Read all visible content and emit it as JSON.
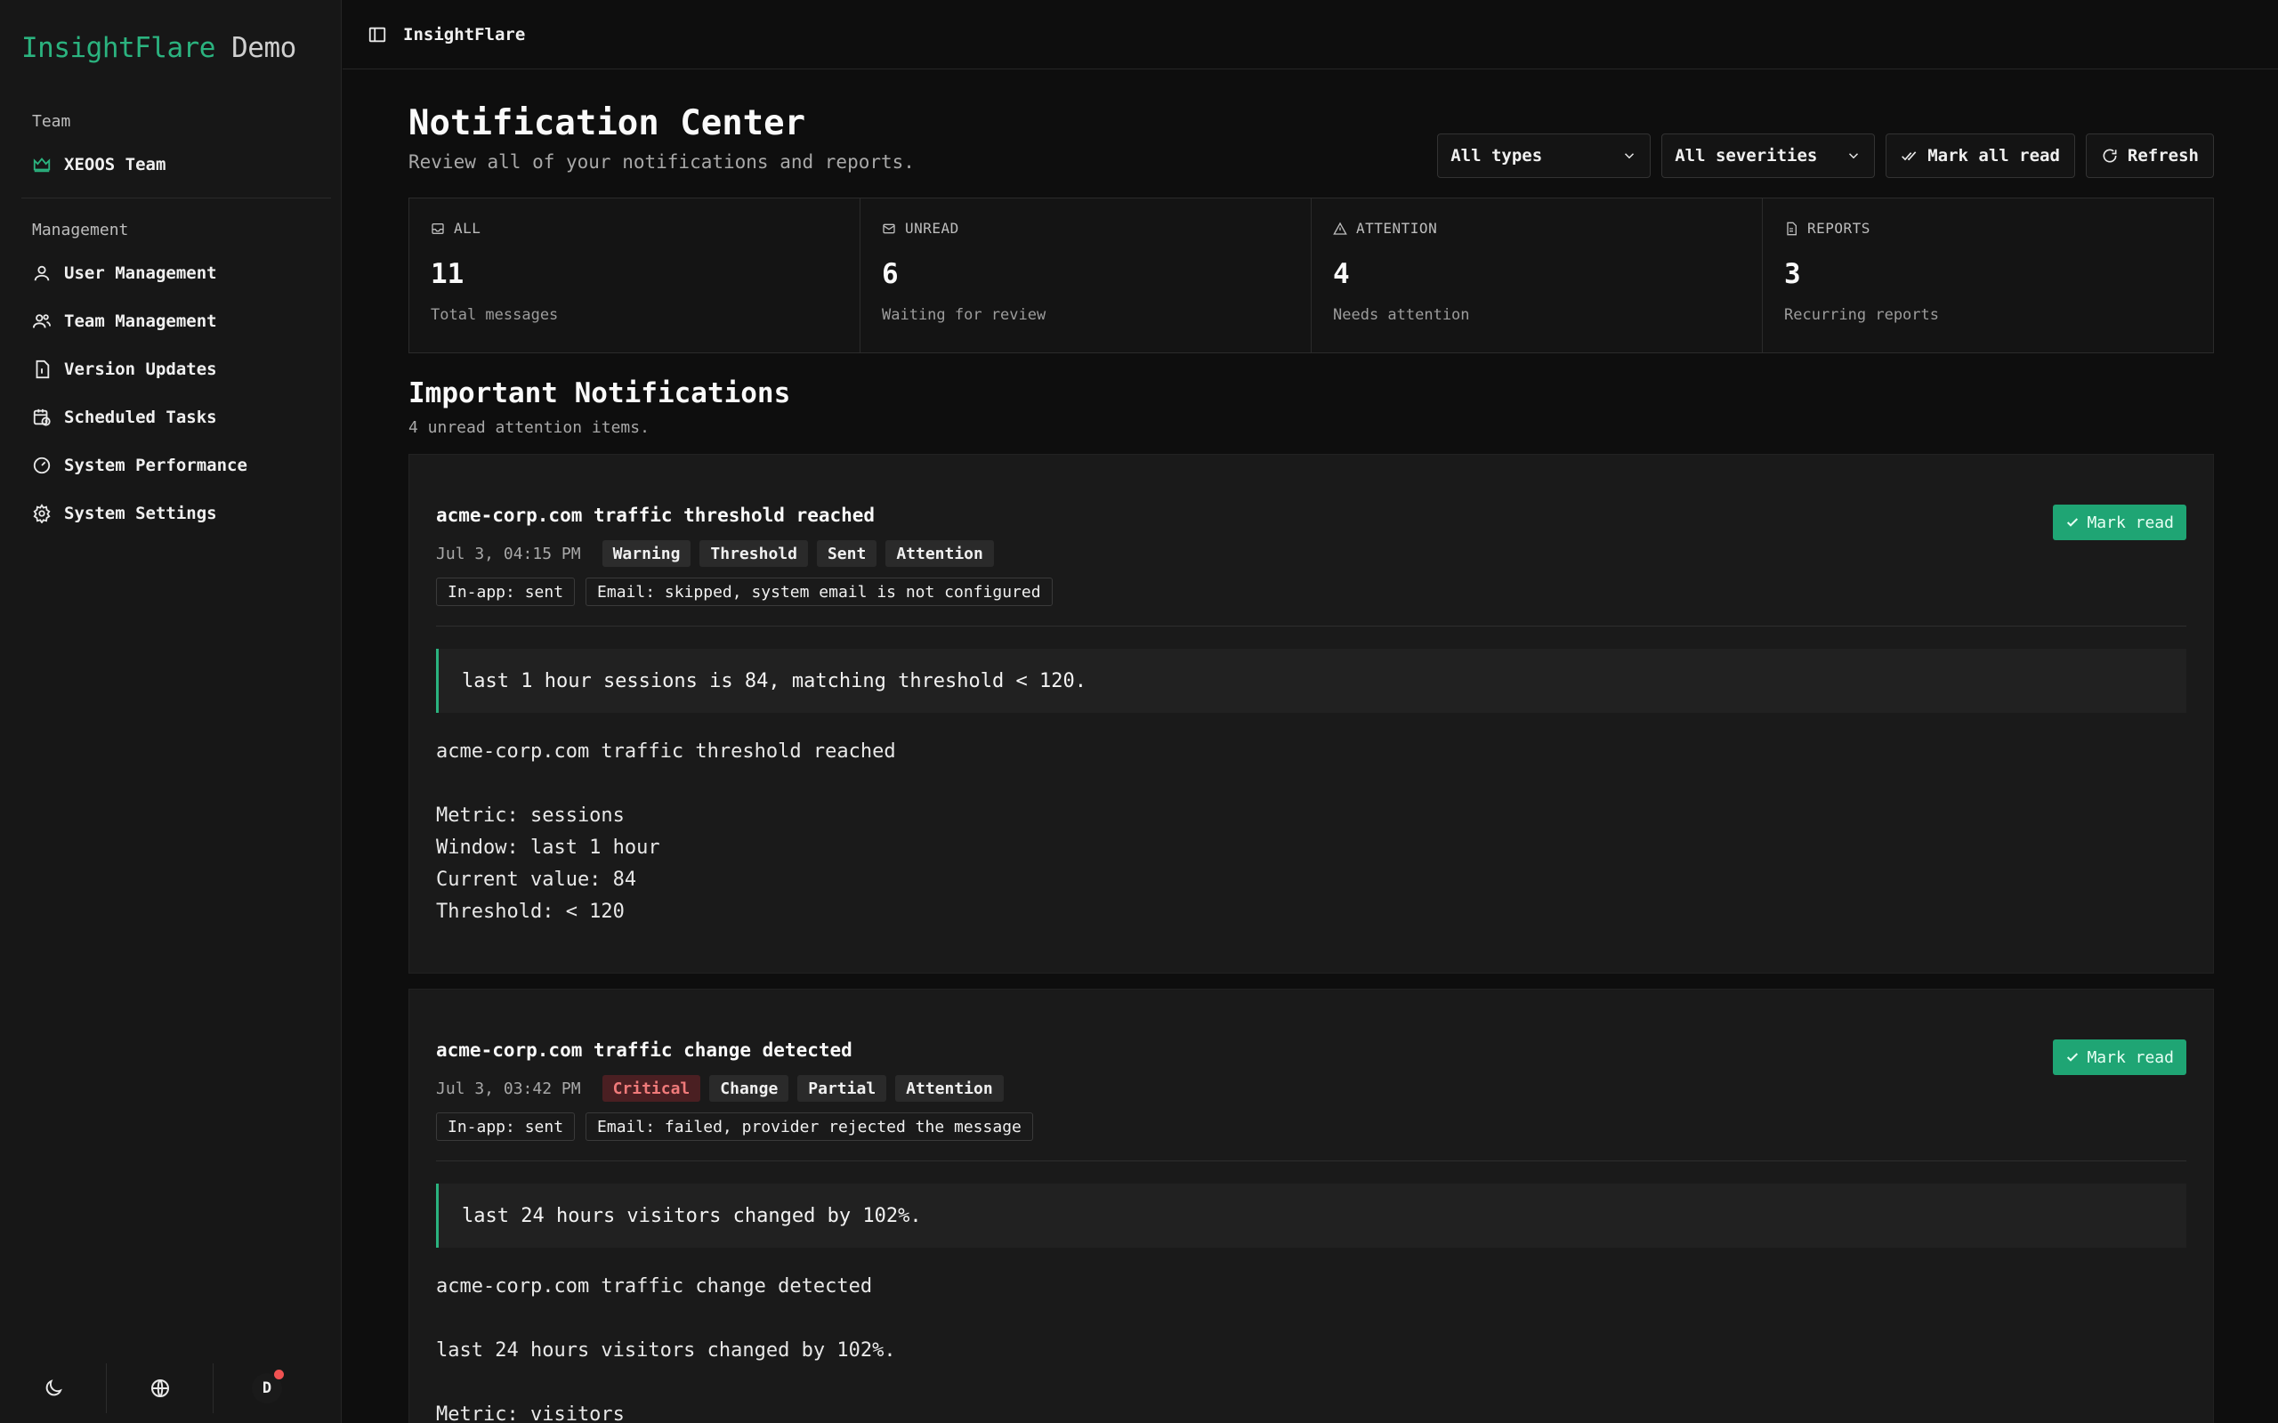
{
  "brand": {
    "name": "InsightFlare",
    "suffix": "Demo"
  },
  "sidebar": {
    "team_label": "Team",
    "team_name": "XEOOS Team",
    "management_label": "Management",
    "items": [
      {
        "label": "User Management",
        "icon": "user-icon"
      },
      {
        "label": "Team Management",
        "icon": "users-icon"
      },
      {
        "label": "Version Updates",
        "icon": "file-icon"
      },
      {
        "label": "Scheduled Tasks",
        "icon": "calendar-clock-icon"
      },
      {
        "label": "System Performance",
        "icon": "gauge-icon"
      },
      {
        "label": "System Settings",
        "icon": "gear-icon"
      }
    ],
    "avatar_initial": "D"
  },
  "topbar": {
    "crumb": "InsightFlare"
  },
  "header": {
    "title": "Notification Center",
    "subtitle": "Review all of your notifications and reports.",
    "type_filter": "All types",
    "severity_filter": "All severities",
    "mark_all_read": "Mark all read",
    "refresh": "Refresh"
  },
  "stats": [
    {
      "label": "ALL",
      "value": "11",
      "desc": "Total messages",
      "icon": "inbox-icon"
    },
    {
      "label": "UNREAD",
      "value": "6",
      "desc": "Waiting for review",
      "icon": "mail-icon"
    },
    {
      "label": "ATTENTION",
      "value": "4",
      "desc": "Needs attention",
      "icon": "warning-icon"
    },
    {
      "label": "REPORTS",
      "value": "3",
      "desc": "Recurring reports",
      "icon": "report-icon"
    }
  ],
  "important": {
    "title": "Important Notifications",
    "subtitle": "4 unread attention items."
  },
  "notifications": [
    {
      "title": "acme-corp.com traffic threshold reached",
      "time": "Jul 3, 04:15 PM",
      "tags": [
        "Warning",
        "Threshold",
        "Sent",
        "Attention"
      ],
      "delivery": [
        "In-app: sent",
        "Email: skipped, system email is not configured"
      ],
      "mark_read": "Mark read",
      "summary": "last 1 hour sessions is 84, matching threshold < 120.",
      "body": [
        "acme-corp.com traffic threshold reached",
        "",
        "Metric: sessions",
        "Window: last 1 hour",
        "Current value: 84",
        "Threshold: < 120"
      ]
    },
    {
      "title": "acme-corp.com traffic change detected",
      "time": "Jul 3, 03:42 PM",
      "tags": [
        "Critical",
        "Change",
        "Partial",
        "Attention"
      ],
      "delivery": [
        "In-app: sent",
        "Email: failed, provider rejected the message"
      ],
      "mark_read": "Mark read",
      "summary": "last 24 hours visitors changed by 102%.",
      "body": [
        "acme-corp.com traffic change detected",
        "",
        "last 24 hours visitors changed by 102%.",
        "",
        "Metric: visitors"
      ]
    }
  ],
  "colors": {
    "accent": "#2bb37f",
    "mark_read_bg": "#1fa574",
    "critical": "#f07a7a"
  }
}
